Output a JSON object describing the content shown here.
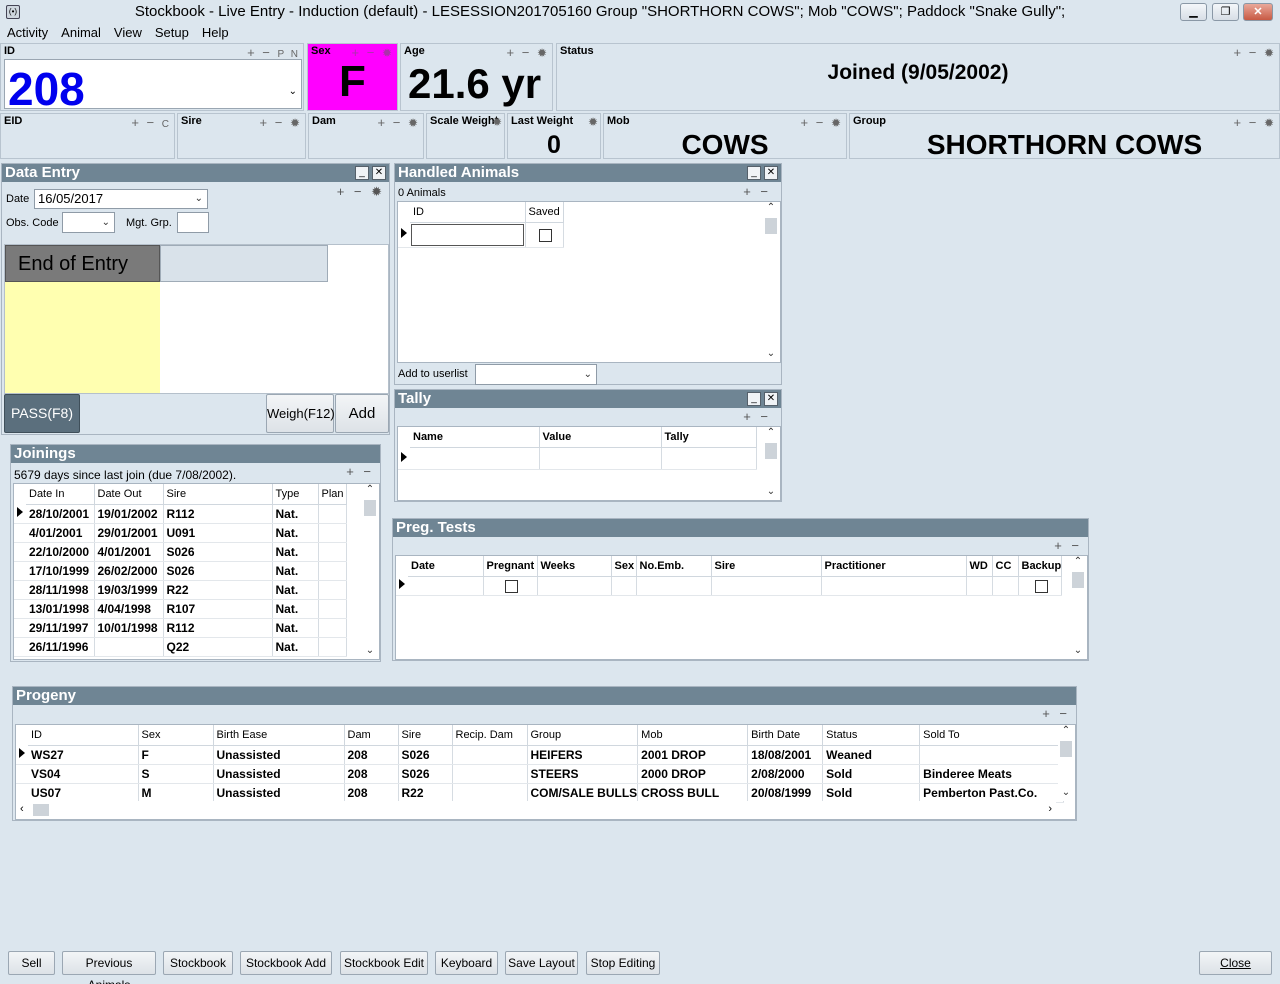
{
  "window": {
    "title": "Stockbook - Live Entry - Induction (default) - LESESSION201705160 Group \"SHORTHORN COWS\"; Mob \"COWS\"; Paddock \"Snake Gully\";"
  },
  "menu": [
    "Activity",
    "Animal",
    "View",
    "Setup",
    "Help"
  ],
  "header": {
    "id": {
      "label": "ID",
      "value": "208",
      "extra": "P N"
    },
    "sex": {
      "label": "Sex",
      "value": "F",
      "color": "#ff00ff"
    },
    "age": {
      "label": "Age",
      "value": "21.6 yr"
    },
    "status": {
      "label": "Status",
      "value": "Joined (9/05/2002)"
    },
    "eid": {
      "label": "EID",
      "extra": "C",
      "value": ""
    },
    "sire": {
      "label": "Sire",
      "value": ""
    },
    "dam": {
      "label": "Dam",
      "value": ""
    },
    "scale_weight": {
      "label": "Scale Weight",
      "value": ""
    },
    "last_weight": {
      "label": "Last Weight",
      "value": "0"
    },
    "mob": {
      "label": "Mob",
      "value": "COWS"
    },
    "group": {
      "label": "Group",
      "value": "SHORTHORN COWS"
    }
  },
  "data_entry": {
    "title": "Data Entry",
    "date_label": "Date",
    "date_value": "16/05/2017",
    "obs_code_label": "Obs. Code",
    "obs_code_value": "",
    "mgt_grp_label": "Mgt. Grp.",
    "mgt_grp_value": "",
    "end_of_entry_label": "End of Entry",
    "pass_label": "PASS(F8)",
    "weigh_label": "Weigh(F12)",
    "add_label": "Add"
  },
  "handled": {
    "title": "Handled Animals",
    "count": "0 Animals",
    "columns": [
      "ID",
      "Saved"
    ],
    "add_to_userlist_label": "Add to userlist",
    "userlist_value": ""
  },
  "tally": {
    "title": "Tally",
    "columns": [
      "Name",
      "Value",
      "Tally"
    ]
  },
  "joinings": {
    "title": "Joinings",
    "summary": "5679 days since last join (due 7/08/2002).",
    "columns": [
      "Date In",
      "Date Out",
      "Sire",
      "Type",
      "Plan"
    ],
    "rows": [
      [
        "28/10/2001",
        "19/01/2002",
        "R112",
        "Nat.",
        ""
      ],
      [
        "4/01/2001",
        "29/01/2001",
        "U091",
        "Nat.",
        ""
      ],
      [
        "22/10/2000",
        "4/01/2001",
        "S026",
        "Nat.",
        ""
      ],
      [
        "17/10/1999",
        "26/02/2000",
        "S026",
        "Nat.",
        ""
      ],
      [
        "28/11/1998",
        "19/03/1999",
        "R22",
        "Nat.",
        ""
      ],
      [
        "13/01/1998",
        "4/04/1998",
        "R107",
        "Nat.",
        ""
      ],
      [
        "29/11/1997",
        "10/01/1998",
        "R112",
        "Nat.",
        ""
      ],
      [
        "26/11/1996",
        "",
        "Q22",
        "Nat.",
        ""
      ]
    ]
  },
  "preg_tests": {
    "title": "Preg. Tests",
    "columns": [
      "Date",
      "Pregnant",
      "Weeks",
      "Sex",
      "No.Emb.",
      "Sire",
      "Practitioner",
      "WD",
      "CC",
      "Backup"
    ]
  },
  "progeny": {
    "title": "Progeny",
    "columns": [
      "ID",
      "Sex",
      "Birth Ease",
      "Dam",
      "Sire",
      "Recip. Dam",
      "Group",
      "Mob",
      "Birth Date",
      "Status",
      "Sold To"
    ],
    "rows": [
      [
        "WS27",
        "F",
        "Unassisted",
        "208",
        "S026",
        "",
        "HEIFERS",
        "2001 DROP",
        "18/08/2001",
        "Weaned",
        ""
      ],
      [
        "VS04",
        "S",
        "Unassisted",
        "208",
        "S026",
        "",
        "STEERS",
        "2000 DROP",
        "2/08/2000",
        "Sold",
        "Binderee Meats"
      ],
      [
        "US07",
        "M",
        "Unassisted",
        "208",
        "R22",
        "",
        "COM/SALE BULLS",
        "CROSS BULL",
        "20/08/1999",
        "Sold",
        "Pemberton Past.Co."
      ]
    ]
  },
  "bottom_buttons": [
    "Sell",
    "Previous Animals",
    "Stockbook",
    "Stockbook Add",
    "Stockbook Edit",
    "Keyboard",
    "Save Layout",
    "Stop Editing"
  ],
  "close_label": "Close"
}
